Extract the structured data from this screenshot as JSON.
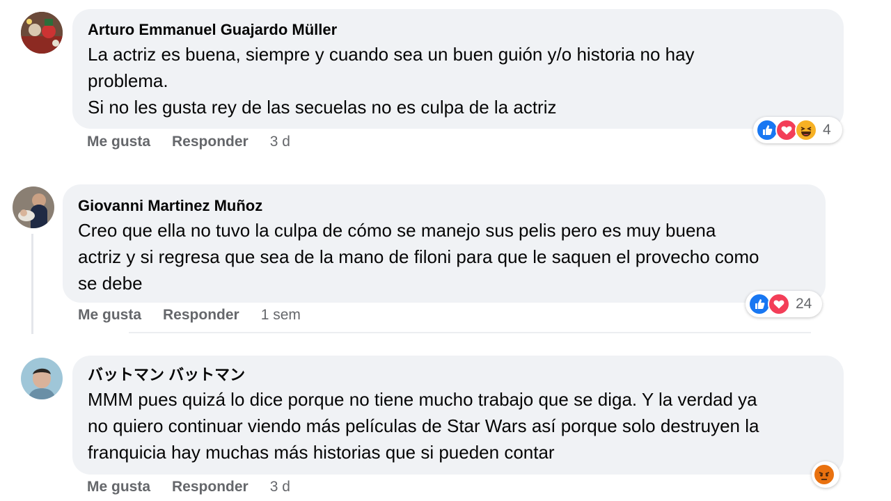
{
  "comments": [
    {
      "author": "Arturo Emmanuel Guajardo Müller",
      "text_lines": [
        "La actriz es buena, siempre y cuando sea un buen guión y/o historia no hay",
        "problema.",
        "Si no les gusta rey de las secuelas no es culpa de la actriz"
      ],
      "like_label": "Me gusta",
      "reply_label": "Responder",
      "time": "3 d",
      "reactions": [
        "like-icon",
        "love-icon",
        "haha-icon"
      ],
      "reaction_count": "4"
    },
    {
      "author": "Giovanni Martinez Muñoz",
      "text_lines": [
        "Creo que ella no tuvo la culpa de cómo se manejo sus pelis pero es muy buena",
        "actriz y si regresa que sea de la mano de filoni para que le saquen el provecho como",
        "se debe"
      ],
      "like_label": "Me gusta",
      "reply_label": "Responder",
      "time": "1 sem",
      "reactions": [
        "like-icon",
        "love-icon"
      ],
      "reaction_count": "24"
    },
    {
      "author": "バットマン バットマン",
      "text_lines": [
        "MMM pues quizá lo dice porque no tiene mucho trabajo que se diga. Y la verdad ya",
        "no quiero continuar viendo más películas de Star Wars así porque solo destruyen la",
        "franquicia hay muchas más historias que si pueden contar"
      ],
      "like_label": "Me gusta",
      "reply_label": "Responder",
      "time": "3 d",
      "reactions": [
        "angry-icon"
      ],
      "reaction_count": ""
    }
  ],
  "colors": {
    "bubble_bg": "#f0f2f5",
    "meta_text": "#65676b",
    "like_blue": "#1877f2",
    "love_red": "#f33e58",
    "haha_yellow": "#f7b125",
    "angry_orange": "#e9710f"
  }
}
